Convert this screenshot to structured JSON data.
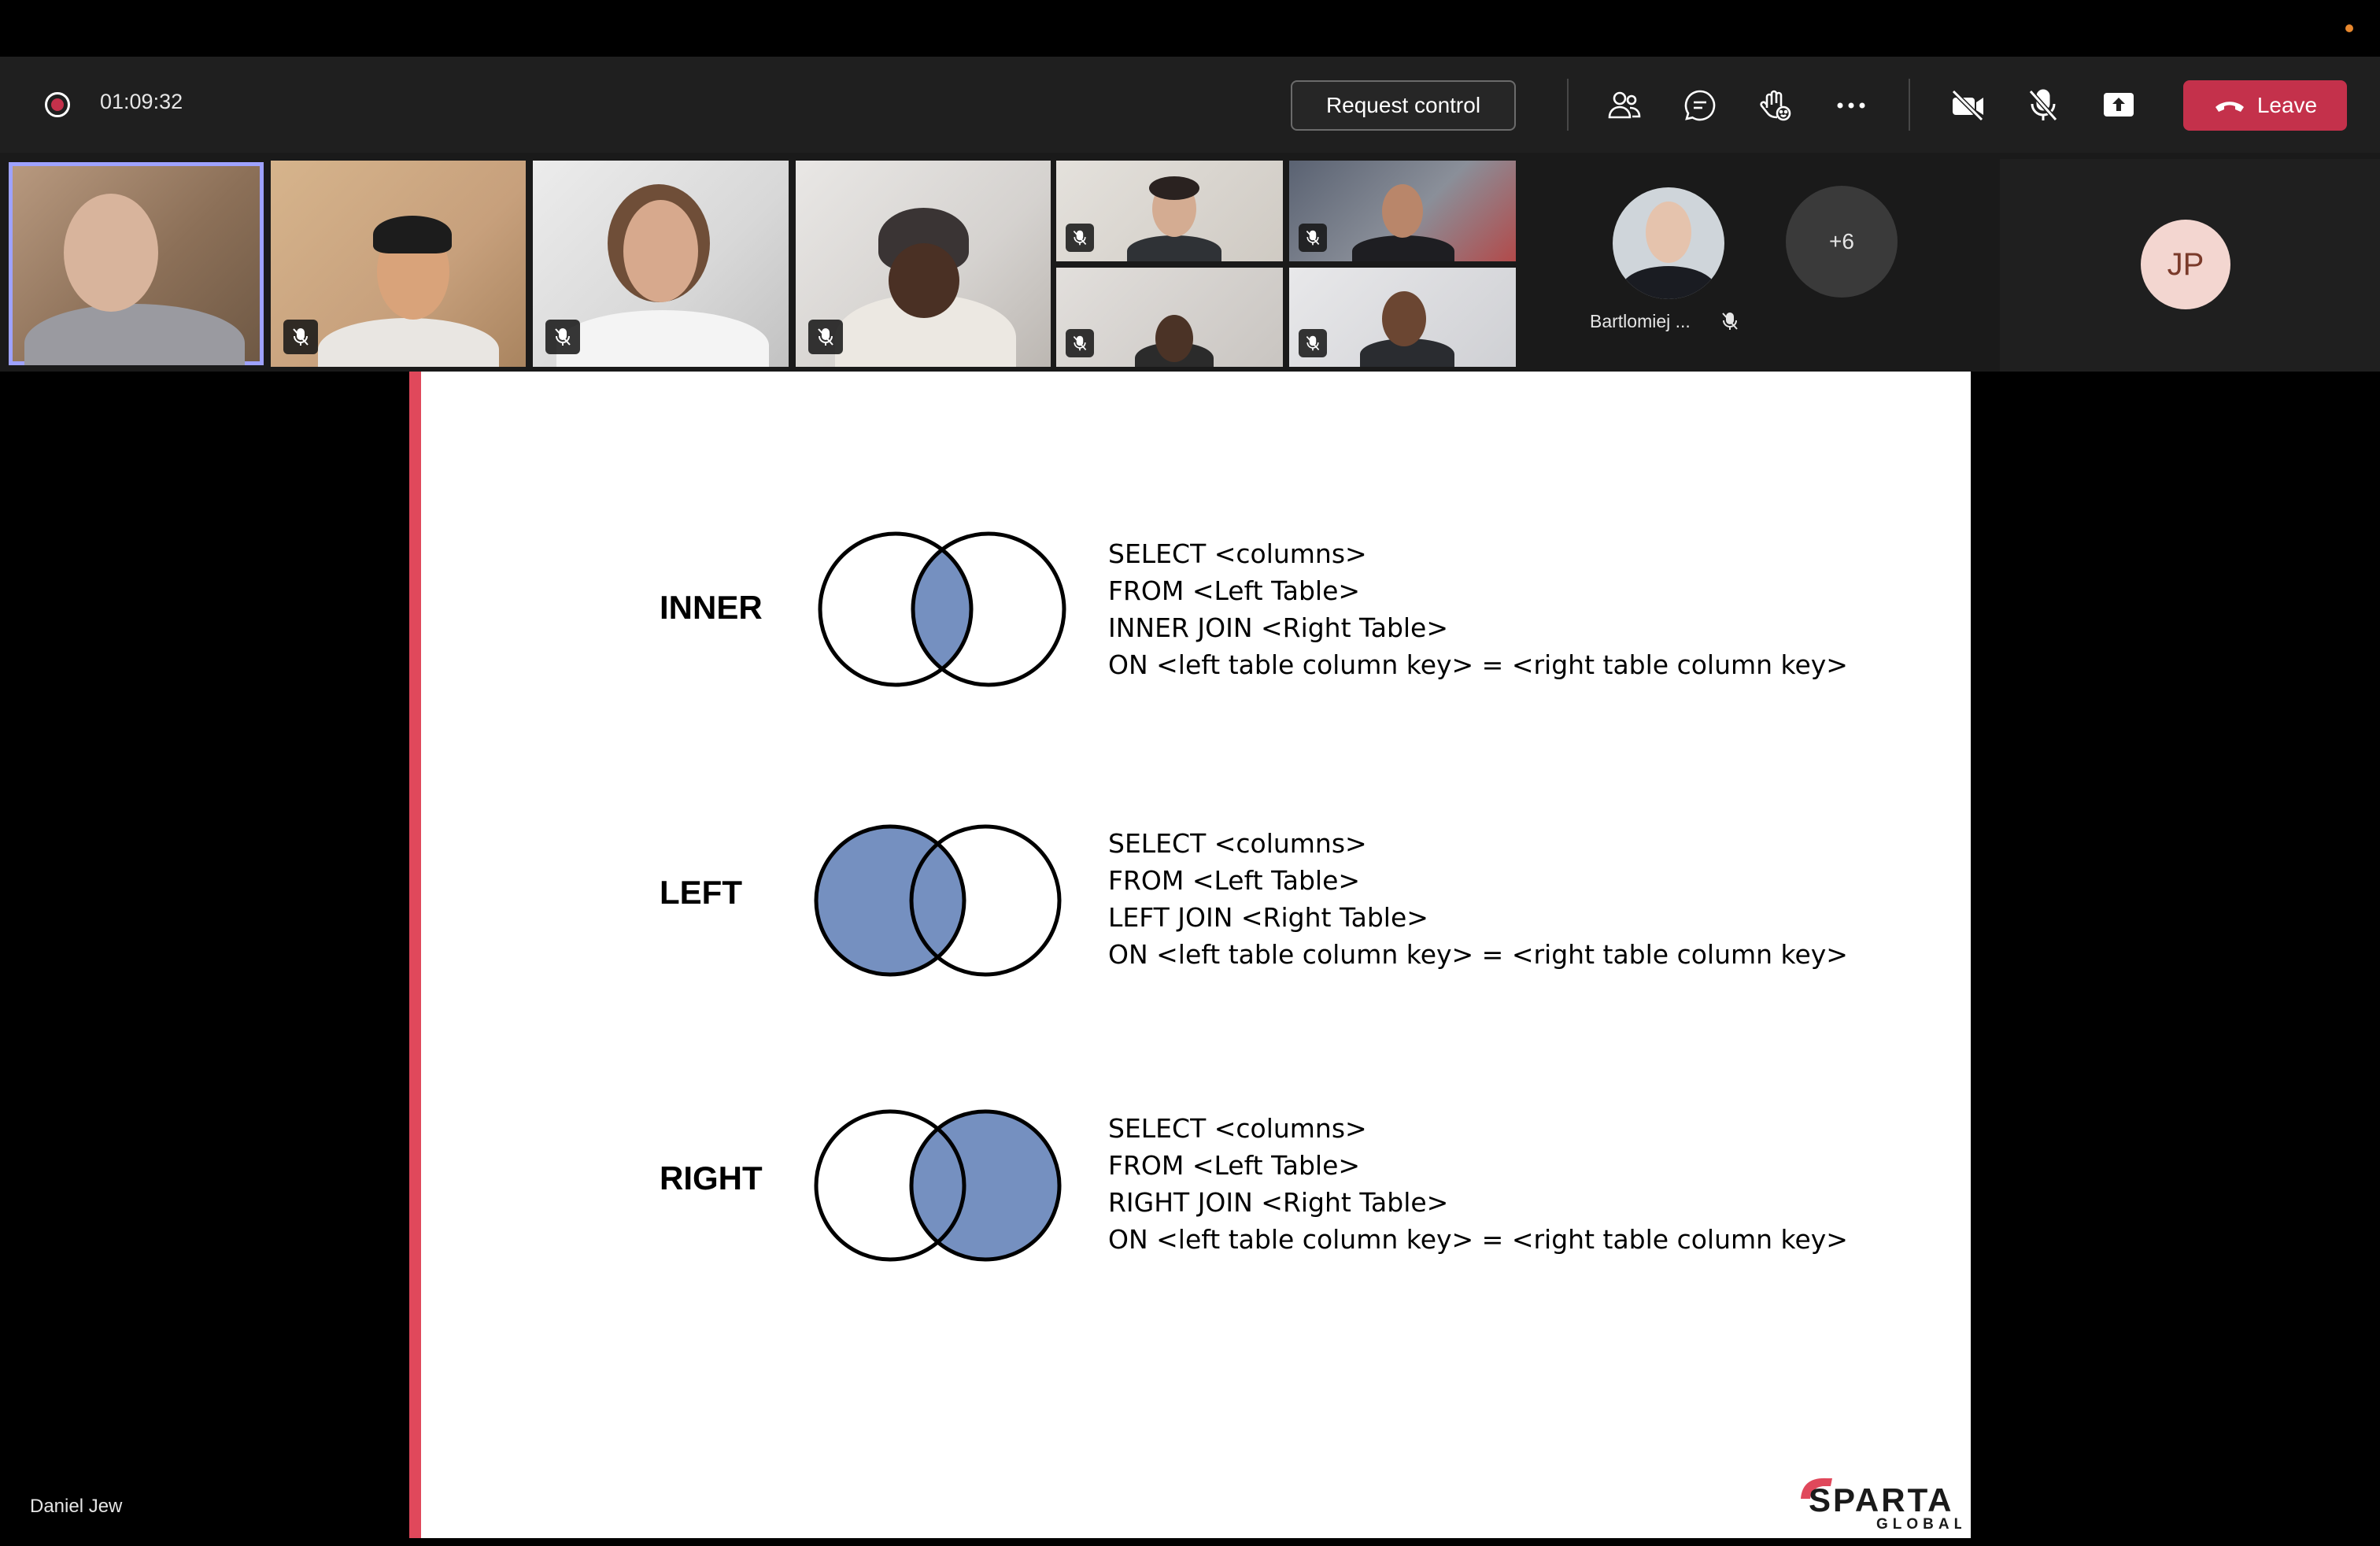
{
  "meeting": {
    "elapsed_time": "01:09:32",
    "request_control_label": "Request control",
    "leave_label": "Leave",
    "colors": {
      "leave": "#c4314b",
      "active_speaker_outline": "#9ea2ff",
      "slide_accent": "#e0485b",
      "venn_fill": "#7590c0"
    }
  },
  "participants": {
    "named_tile_name": "Bartlomiej ...",
    "overflow_count": "+6",
    "initials_avatar": "JP",
    "presenter_name": "Daniel Jew"
  },
  "slide": {
    "joins": [
      {
        "label": "INNER",
        "highlight": "intersection",
        "sql": [
          "SELECT <columns>",
          "FROM <Left Table>",
          "INNER JOIN <Right Table>",
          "ON <left table column key> = <right table column key>"
        ]
      },
      {
        "label": "LEFT",
        "highlight": "left",
        "sql": [
          "SELECT <columns>",
          "FROM <Left Table>",
          "LEFT JOIN <Right Table>",
          "ON <left table column key> = <right table column key>"
        ]
      },
      {
        "label": "RIGHT",
        "highlight": "right",
        "sql": [
          "SELECT <columns>",
          "FROM <Left Table>",
          "RIGHT JOIN <Right Table>",
          "ON <left table column key> = <right table column key>"
        ]
      }
    ],
    "logo": {
      "main": "SPARTA",
      "sub": "GLOBAL"
    }
  }
}
